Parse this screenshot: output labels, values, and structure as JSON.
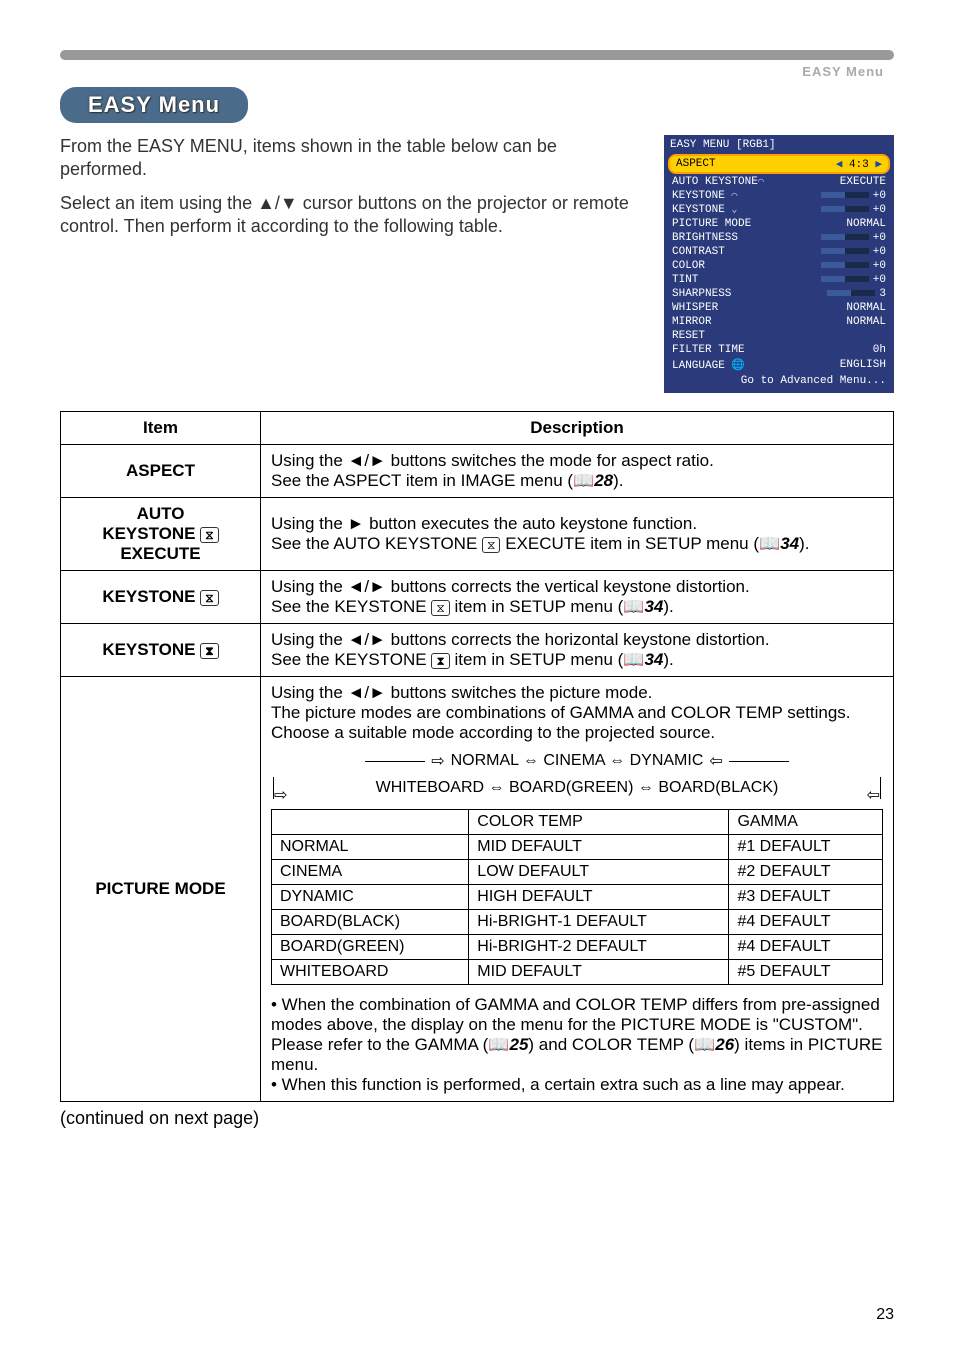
{
  "breadcrumb": "EASY Menu",
  "heading": "EASY Menu",
  "intro": {
    "p1": "From the EASY MENU, items shown in the table below can be performed.",
    "p2": "Select an item using the ▲/▼ cursor buttons on the projector or remote control. Then perform it according to the following table."
  },
  "screenshot": {
    "title": "EASY MENU [RGB1]",
    "rows": [
      {
        "label": "ASPECT",
        "left_arrow": "◀",
        "value": "4:3",
        "right_arrow": "▶",
        "highlighted": true
      },
      {
        "label": "AUTO KEYSTONE",
        "icon": "⌒",
        "value": "EXECUTE"
      },
      {
        "label": "KEYSTONE",
        "icon": "⌒",
        "value": "+0",
        "bar": true
      },
      {
        "label": "KEYSTONE",
        "icon": "⌄",
        "value": "+0",
        "bar": true
      },
      {
        "label": "PICTURE MODE",
        "value": "NORMAL"
      },
      {
        "label": "BRIGHTNESS",
        "value": "+0",
        "bar": true
      },
      {
        "label": "CONTRAST",
        "value": "+0",
        "bar": true
      },
      {
        "label": "COLOR",
        "value": "+0",
        "bar": true
      },
      {
        "label": "TINT",
        "value": "+0",
        "bar": true
      },
      {
        "label": "SHARPNESS",
        "value": "3",
        "bar": true
      },
      {
        "label": "WHISPER",
        "value": "NORMAL"
      },
      {
        "label": "MIRROR",
        "value": "NORMAL"
      },
      {
        "label": "RESET",
        "value": ""
      },
      {
        "label": "FILTER TIME",
        "value": "0h"
      },
      {
        "label": "LANGUAGE",
        "icon": "🌐",
        "value": "ENGLISH"
      }
    ],
    "footer": "Go to Advanced Menu..."
  },
  "table": {
    "headers": {
      "item": "Item",
      "description": "Description"
    },
    "aspect": {
      "name": "ASPECT",
      "desc_line1": "Using the ◄/► buttons switches the mode for aspect ratio.",
      "desc_line2_a": "See the ASPECT item in IMAGE menu (",
      "desc_line2_ref": "28",
      "desc_line2_b": ")."
    },
    "auto_keystone": {
      "name_l1": "AUTO",
      "name_l2": "KEYSTONE ",
      "name_l3": "EXECUTE",
      "desc_line1": "Using the ► button executes the auto keystone function.",
      "desc_line2_a": "See the AUTO KEYSTONE ",
      "desc_line2_mid": " EXECUTE item in SETUP menu (",
      "desc_line2_ref": "34",
      "desc_line2_b": ")."
    },
    "keystone_v": {
      "name": "KEYSTONE ",
      "desc_line1": "Using the ◄/► buttons corrects the vertical keystone distortion.",
      "desc_line2_a": "See the KEYSTONE ",
      "desc_line2_mid": " item in SETUP menu (",
      "desc_line2_ref": "34",
      "desc_line2_b": ")."
    },
    "keystone_h": {
      "name": "KEYSTONE ",
      "desc_line1": "Using the ◄/► buttons corrects the horizontal keystone distortion.",
      "desc_line2_a": "See the KEYSTONE ",
      "desc_line2_mid": " item in SETUP menu (",
      "desc_line2_ref": "34",
      "desc_line2_b": ")."
    },
    "picture_mode": {
      "name": "PICTURE MODE",
      "p1": "Using the ◄/► buttons switches the picture mode.",
      "p2": "The picture modes are combinations of GAMMA and COLOR TEMP settings. Choose a suitable mode according to the projected source.",
      "diagram_top": "NORMAL ⇔ CINEMA ⇔ DYNAMIC",
      "diagram_bottom": "WHITEBOARD ⇔ BOARD(GREEN) ⇔ BOARD(BLACK)",
      "inner_headers": {
        "blank": "",
        "ct": "COLOR TEMP",
        "g": "GAMMA"
      },
      "inner_rows": [
        {
          "m": "NORMAL",
          "ct": "MID DEFAULT",
          "g": "#1 DEFAULT"
        },
        {
          "m": "CINEMA",
          "ct": "LOW DEFAULT",
          "g": "#2 DEFAULT"
        },
        {
          "m": "DYNAMIC",
          "ct": "HIGH DEFAULT",
          "g": "#3 DEFAULT"
        },
        {
          "m": "BOARD(BLACK)",
          "ct": "Hi-BRIGHT-1 DEFAULT",
          "g": "#4 DEFAULT"
        },
        {
          "m": "BOARD(GREEN)",
          "ct": "Hi-BRIGHT-2 DEFAULT",
          "g": "#4 DEFAULT"
        },
        {
          "m": "WHITEBOARD",
          "ct": "MID DEFAULT",
          "g": "#5 DEFAULT"
        }
      ],
      "note1_a": "• When the combination of GAMMA and COLOR TEMP differs from pre-assigned modes above, the display on the menu for the PICTURE MODE is \"CUSTOM\". Please refer to the GAMMA (",
      "note1_ref1": "25",
      "note1_b": ") and COLOR TEMP (",
      "note1_ref2": "26",
      "note1_c": ") items in PICTURE menu.",
      "note2": "• When this function is performed, a certain extra such as a line may appear."
    }
  },
  "continued": "(continued on next page)",
  "page_number": "23",
  "icons": {
    "trap_v": "⬘",
    "trap_h": "⬔",
    "book": "📖"
  }
}
